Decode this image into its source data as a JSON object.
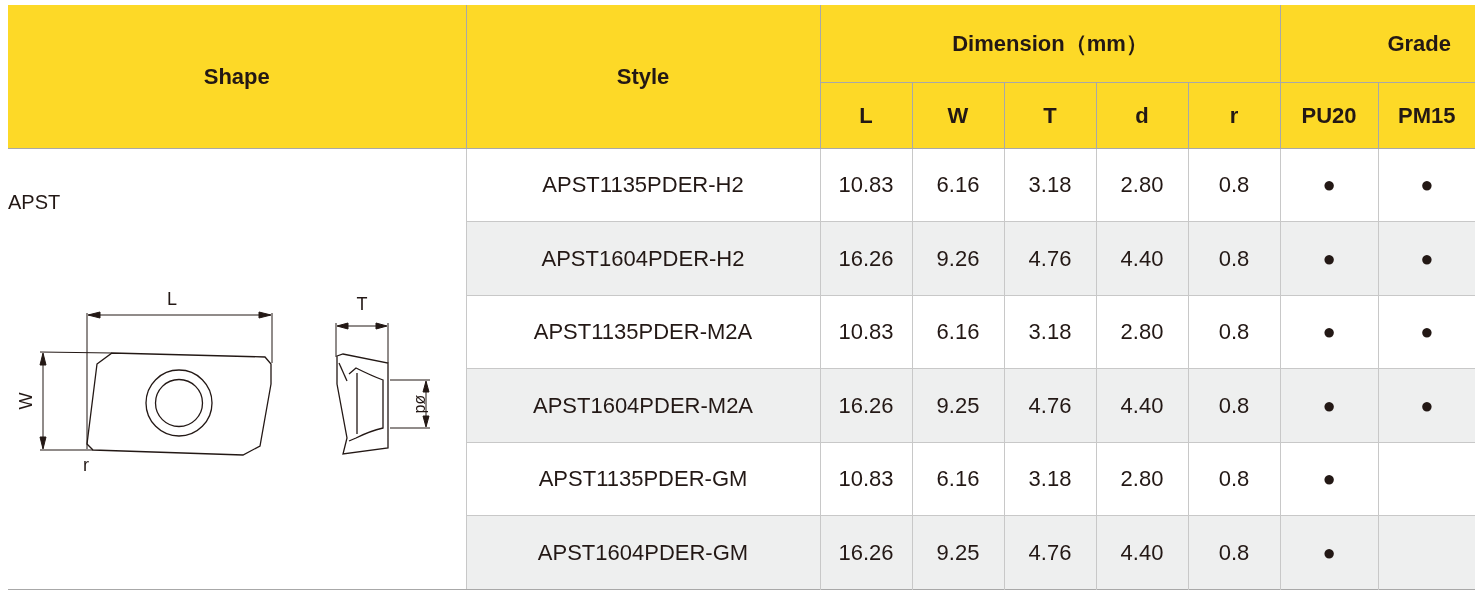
{
  "header": {
    "shape": "Shape",
    "style": "Style",
    "dimension": "Dimension（mm）",
    "grade": "Grade",
    "dimension_columns": [
      "L",
      "W",
      "T",
      "d",
      "r"
    ],
    "grade_columns": [
      "PU20",
      "PM15"
    ]
  },
  "shape": {
    "name": "APST",
    "labels": {
      "length": "L",
      "width": "W",
      "radius": "r",
      "thickness": "T",
      "diameter": "ød"
    }
  },
  "rows": [
    {
      "style": "APST1135PDER-H2",
      "dims": [
        "10.83",
        "6.16",
        "3.18",
        "2.80",
        "0.8"
      ],
      "grades": [
        "●",
        "●"
      ]
    },
    {
      "style": "APST1604PDER-H2",
      "dims": [
        "16.26",
        "9.26",
        "4.76",
        "4.40",
        "0.8"
      ],
      "grades": [
        "●",
        "●"
      ]
    },
    {
      "style": "APST1135PDER-M2A",
      "dims": [
        "10.83",
        "6.16",
        "3.18",
        "2.80",
        "0.8"
      ],
      "grades": [
        "●",
        "●"
      ]
    },
    {
      "style": "APST1604PDER-M2A",
      "dims": [
        "16.26",
        "9.25",
        "4.76",
        "4.40",
        "0.8"
      ],
      "grades": [
        "●",
        "●"
      ]
    },
    {
      "style": "APST1135PDER-GM",
      "dims": [
        "10.83",
        "6.16",
        "3.18",
        "2.80",
        "0.8"
      ],
      "grades": [
        "●"
      ]
    },
    {
      "style": "APST1604PDER-GM",
      "dims": [
        "16.26",
        "9.25",
        "4.76",
        "4.40",
        "0.8"
      ],
      "grades": [
        "●"
      ]
    }
  ]
}
